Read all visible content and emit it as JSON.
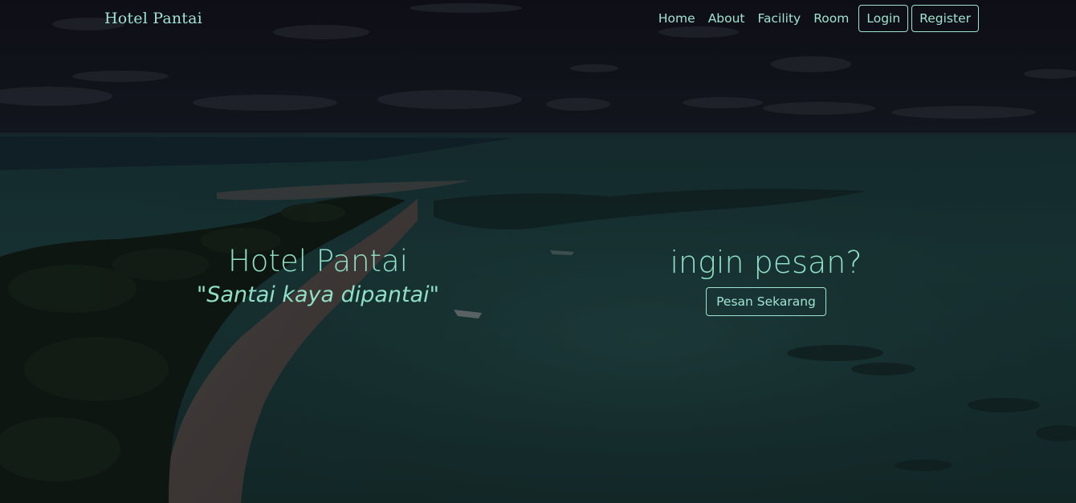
{
  "colors": {
    "accent": "#9fe3d0",
    "overlay": "#000000"
  },
  "navbar": {
    "brand": "Hotel Pantai",
    "links": [
      "Home",
      "About",
      "Facility",
      "Room"
    ],
    "login_label": "Login",
    "register_label": "Register"
  },
  "hero": {
    "title": "Hotel Pantai",
    "tagline": "\"Santai kaya dipantai\"",
    "cta_title": "ingin pesan?",
    "cta_button": "Pesan Sekarang"
  }
}
